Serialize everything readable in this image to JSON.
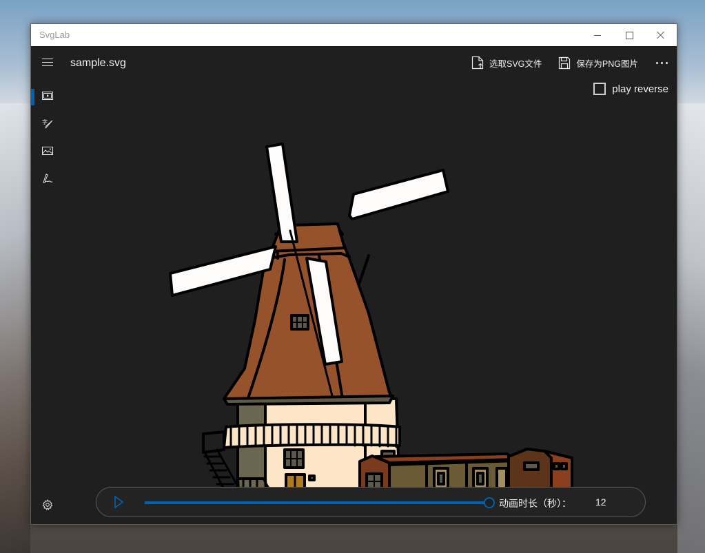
{
  "window": {
    "title": "SvgLab",
    "controls": {
      "minimize": "minimize",
      "maximize": "maximize",
      "close": "close"
    }
  },
  "nav": {
    "items": [
      {
        "id": "player",
        "icon": "video-frame-icon",
        "selected": true
      },
      {
        "id": "text",
        "icon": "text-brush-icon",
        "selected": false
      },
      {
        "id": "image",
        "icon": "image-icon",
        "selected": false
      },
      {
        "id": "signature",
        "icon": "pen-signature-icon",
        "selected": false
      }
    ],
    "settings_icon": "gear-icon"
  },
  "header": {
    "file_name": "sample.svg",
    "commands": [
      {
        "label": "选取SVG文件",
        "icon": "file-upload-icon"
      },
      {
        "label": "保存为PNG图片",
        "icon": "floppy-save-icon"
      }
    ],
    "more_icon": "more-dots-icon"
  },
  "options": {
    "play_reverse_label": "play reverse",
    "play_reverse_checked": false
  },
  "canvas": {
    "subject": "windmill illustration",
    "colors": {
      "roof": "#96522a",
      "wall": "#fde6c7",
      "sail": "#fdfcfa",
      "outline": "#000000",
      "door": "#b07a1f",
      "shed_brown": "#7a3a1e",
      "shed_dark": "#5b3419",
      "shed_olive": "#6b5a36",
      "shed_tan": "#a38f62",
      "side_gray": "#6a6650"
    }
  },
  "player": {
    "play_icon": "play-icon",
    "progress": 1.0,
    "duration_label": "动画时长（秒）：",
    "duration_value": "12"
  },
  "accent": "#0063b1"
}
